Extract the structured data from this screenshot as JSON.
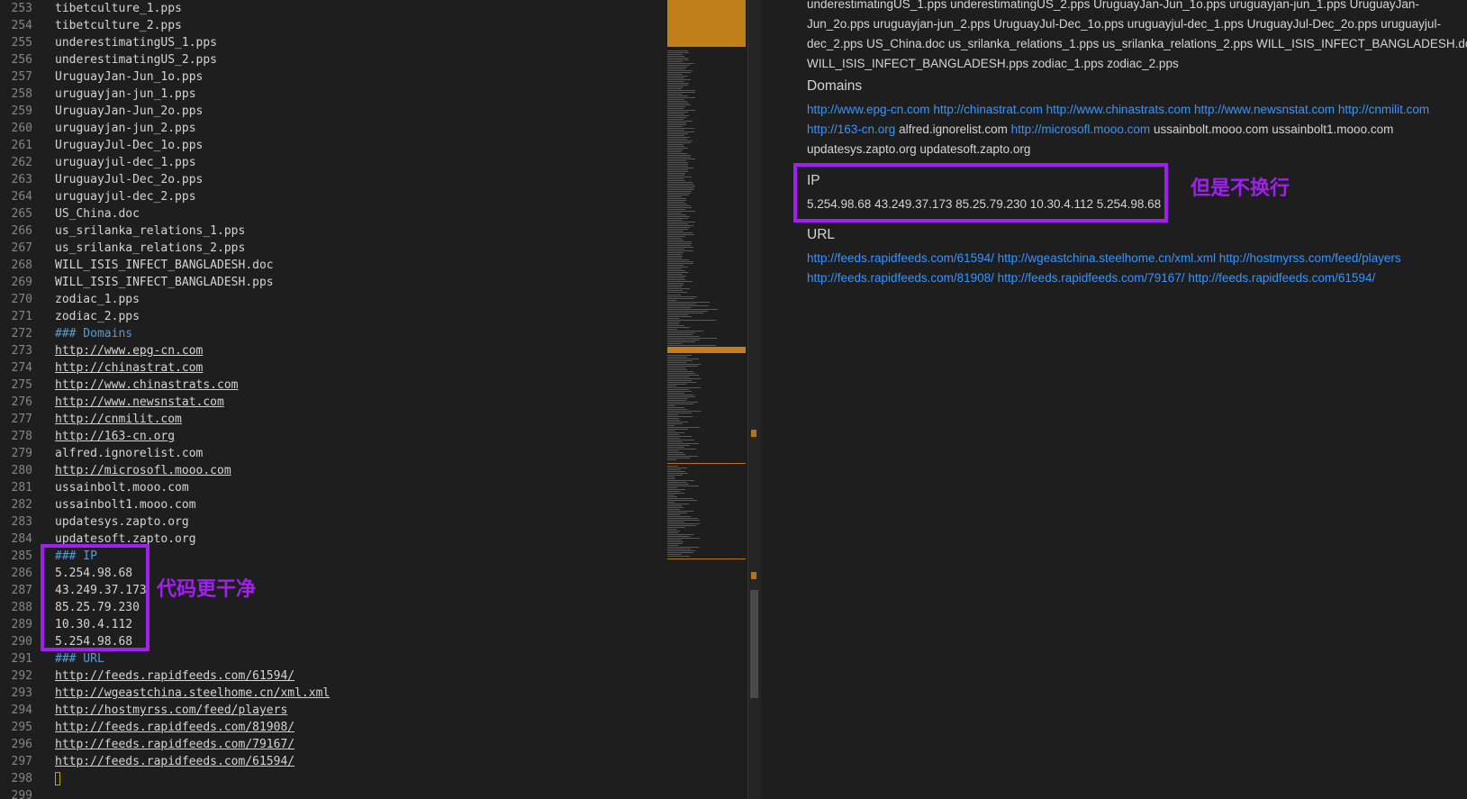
{
  "editor": {
    "lines": [
      {
        "n": "253",
        "t": "tibetculture_1.pps",
        "k": "text"
      },
      {
        "n": "254",
        "t": "tibetculture_2.pps",
        "k": "text"
      },
      {
        "n": "255",
        "t": "underestimatingUS_1.pps",
        "k": "text"
      },
      {
        "n": "256",
        "t": "underestimatingUS_2.pps",
        "k": "text"
      },
      {
        "n": "257",
        "t": "UruguayJan-Jun_1o.pps",
        "k": "text"
      },
      {
        "n": "258",
        "t": "uruguayjan-jun_1.pps",
        "k": "text"
      },
      {
        "n": "259",
        "t": "UruguayJan-Jun_2o.pps",
        "k": "text"
      },
      {
        "n": "260",
        "t": "uruguayjan-jun_2.pps",
        "k": "text"
      },
      {
        "n": "261",
        "t": "UruguayJul-Dec_1o.pps",
        "k": "text"
      },
      {
        "n": "262",
        "t": "uruguayjul-dec_1.pps",
        "k": "text"
      },
      {
        "n": "263",
        "t": "UruguayJul-Dec_2o.pps",
        "k": "text"
      },
      {
        "n": "264",
        "t": "uruguayjul-dec_2.pps",
        "k": "text"
      },
      {
        "n": "265",
        "t": "US_China.doc",
        "k": "text"
      },
      {
        "n": "266",
        "t": "us_srilanka_relations_1.pps",
        "k": "text"
      },
      {
        "n": "267",
        "t": "us_srilanka_relations_2.pps",
        "k": "text"
      },
      {
        "n": "268",
        "t": "WILL_ISIS_INFECT_BANGLADESH.doc",
        "k": "text"
      },
      {
        "n": "269",
        "t": "WILL_ISIS_INFECT_BANGLADESH.pps",
        "k": "text"
      },
      {
        "n": "270",
        "t": "zodiac_1.pps",
        "k": "text"
      },
      {
        "n": "271",
        "t": "zodiac_2.pps",
        "k": "text"
      },
      {
        "n": "272",
        "t": "### Domains",
        "k": "heading"
      },
      {
        "n": "273",
        "t": "http://www.epg-cn.com",
        "k": "link"
      },
      {
        "n": "274",
        "t": "http://chinastrat.com",
        "k": "link"
      },
      {
        "n": "275",
        "t": "http://www.chinastrats.com",
        "k": "link"
      },
      {
        "n": "276",
        "t": "http://www.newsnstat.com",
        "k": "link"
      },
      {
        "n": "277",
        "t": "http://cnmilit.com",
        "k": "link"
      },
      {
        "n": "278",
        "t": "http://163-cn.org",
        "k": "link"
      },
      {
        "n": "279",
        "t": "alfred.ignorelist.com",
        "k": "text"
      },
      {
        "n": "280",
        "t": "http://microsofl.mooo.com",
        "k": "link"
      },
      {
        "n": "281",
        "t": "ussainbolt.mooo.com",
        "k": "text"
      },
      {
        "n": "282",
        "t": "ussainbolt1.mooo.com",
        "k": "text"
      },
      {
        "n": "283",
        "t": "updatesys.zapto.org",
        "k": "text"
      },
      {
        "n": "284",
        "t": "updatesoft.zapto.org",
        "k": "text"
      },
      {
        "n": "285",
        "t": "### IP",
        "k": "heading"
      },
      {
        "n": "286",
        "t": "5.254.98.68",
        "k": "text"
      },
      {
        "n": "287",
        "t": "43.249.37.173",
        "k": "text"
      },
      {
        "n": "288",
        "t": "85.25.79.230",
        "k": "text"
      },
      {
        "n": "289",
        "t": "10.30.4.112",
        "k": "text"
      },
      {
        "n": "290",
        "t": "5.254.98.68",
        "k": "text"
      },
      {
        "n": "291",
        "t": "### URL",
        "k": "heading"
      },
      {
        "n": "292",
        "t": "http://feeds.rapidfeeds.com/61594/",
        "k": "link"
      },
      {
        "n": "293",
        "t": "http://wgeastchina.steelhome.cn/xml.xml",
        "k": "link"
      },
      {
        "n": "294",
        "t": "http://hostmyrss.com/feed/players",
        "k": "link"
      },
      {
        "n": "295",
        "t": "http://feeds.rapidfeeds.com/81908/",
        "k": "link"
      },
      {
        "n": "296",
        "t": "http://feeds.rapidfeeds.com/79167/",
        "k": "link"
      },
      {
        "n": "297",
        "t": "http://feeds.rapidfeeds.com/61594/",
        "k": "link"
      },
      {
        "n": "298",
        "t": "",
        "k": "cursor"
      },
      {
        "n": "299",
        "t": "",
        "k": "text"
      }
    ],
    "annotation": "代码更干净"
  },
  "preview": {
    "top_lines": [
      [
        {
          "t": "underestimatingUS_1.pps underestimatingUS_2.pps UruguayJan-Jun_1o.pps uruguayjan-jun_1.pps UruguayJan-",
          "k": "plain"
        }
      ],
      [
        {
          "t": "Jun_2o.pps uruguayjan-jun_2.pps UruguayJul-Dec_1o.pps uruguayjul-dec_1.pps UruguayJul-Dec_2o.pps uruguayjul-",
          "k": "plain"
        }
      ],
      [
        {
          "t": "dec_2.pps US_China.doc us_srilanka_relations_1.pps us_srilanka_relations_2.pps WILL_ISIS_INFECT_BANGLADESH.doc",
          "k": "plain"
        }
      ],
      [
        {
          "t": "WILL_ISIS_INFECT_BANGLADESH.pps zodiac_1.pps zodiac_2.pps",
          "k": "plain"
        }
      ]
    ],
    "domains_heading": "Domains",
    "domains_lines": [
      [
        {
          "t": "http://www.epg-cn.com",
          "k": "link"
        },
        {
          "t": " ",
          "k": "plain"
        },
        {
          "t": "http://chinastrat.com",
          "k": "link"
        },
        {
          "t": " ",
          "k": "plain"
        },
        {
          "t": "http://www.chinastrats.com",
          "k": "link"
        },
        {
          "t": " ",
          "k": "plain"
        },
        {
          "t": "http://www.newsnstat.com",
          "k": "link"
        },
        {
          "t": " ",
          "k": "plain"
        },
        {
          "t": "http://cnmilit.com",
          "k": "link"
        }
      ],
      [
        {
          "t": "http://163-cn.org",
          "k": "link"
        },
        {
          "t": " alfred.ignorelist.com ",
          "k": "plain"
        },
        {
          "t": "http://microsofl.mooo.com",
          "k": "link"
        },
        {
          "t": " ussainbolt.mooo.com ussainbolt1.mooo.com",
          "k": "plain"
        }
      ],
      [
        {
          "t": "updatesys.zapto.org updatesoft.zapto.org",
          "k": "plain"
        }
      ]
    ],
    "ip_heading": "IP",
    "ip_line": "5.254.98.68 43.249.37.173 85.25.79.230 10.30.4.112 5.254.98.68",
    "url_heading": "URL",
    "url_lines": [
      [
        {
          "t": "http://feeds.rapidfeeds.com/61594/",
          "k": "link"
        },
        {
          "t": " ",
          "k": "plain"
        },
        {
          "t": "http://wgeastchina.steelhome.cn/xml.xml",
          "k": "link"
        },
        {
          "t": " ",
          "k": "plain"
        },
        {
          "t": "http://hostmyrss.com/feed/players",
          "k": "link"
        }
      ],
      [
        {
          "t": "http://feeds.rapidfeeds.com/81908/",
          "k": "link"
        },
        {
          "t": " ",
          "k": "plain"
        },
        {
          "t": "http://feeds.rapidfeeds.com/79167/",
          "k": "link"
        },
        {
          "t": " ",
          "k": "plain"
        },
        {
          "t": "http://feeds.rapidfeeds.com/61594/",
          "k": "link"
        }
      ]
    ],
    "annotation": "但是不换行"
  },
  "colors": {
    "annotation": "#a020f0",
    "link": "#3794ff",
    "heading": "#569cd6"
  }
}
